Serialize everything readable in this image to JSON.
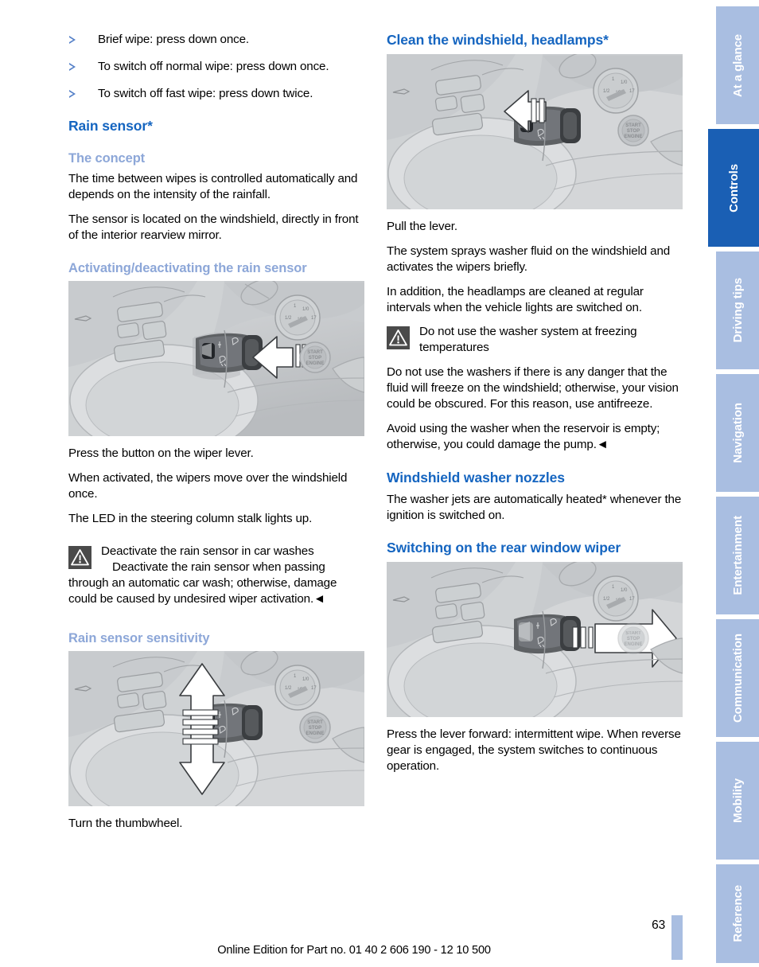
{
  "document": {
    "page_number": "63",
    "footer": "Online Edition for Part no. 01 40 2 606 190 - 12 10 500"
  },
  "left_column": {
    "bullets": [
      "Brief wipe: press down once.",
      "To switch off normal wipe: press down once.",
      "To switch off fast wipe: press down twice."
    ],
    "rain_sensor_heading": "Rain sensor*",
    "concept_heading": "The concept",
    "concept_p1": "The time between wipes is controlled automatically and depends on the intensity of the rainfall.",
    "concept_p2": "The sensor is located on the windshield, directly in front of the interior rearview mirror.",
    "activating_heading": "Activating/deactivating the rain sensor",
    "figure1_caption": "figure-wiper-lever-button-left-arrow",
    "activating_p1": "Press the button on the wiper lever.",
    "activating_p2": "When activated, the wipers move over the windshield once.",
    "activating_p3": "The LED in the steering column stalk lights up.",
    "warning_title": "Deactivate the rain sensor in car washes",
    "warning_body": "Deactivate the rain sensor when passing through an automatic car wash; otherwise, damage could be caused by undesired wiper activation.◄",
    "sensitivity_heading": "Rain sensor sensitivity",
    "figure2_caption": "figure-thumbwheel-up-down-arrow",
    "sensitivity_p1": "Turn the thumbwheel."
  },
  "right_column": {
    "clean_heading": "Clean the windshield, headlamps*",
    "figure3_caption": "figure-pull-lever-left-arrow",
    "clean_p1": "Pull the lever.",
    "clean_p2": "The system sprays washer fluid on the windshield and activates the wipers briefly.",
    "clean_p3": "In addition, the headlamps are cleaned at regular intervals when the vehicle lights are switched on.",
    "warning_title": "Do not use the washer system at freezing temperatures",
    "warning_p1": "Do not use the washers if there is any danger that the fluid will freeze on the windshield; otherwise, your vision could be obscured. For this reason, use antifreeze.",
    "warning_p2": "Avoid using the washer when the reservoir is empty; otherwise, you could damage the pump.◄",
    "nozzles_heading": "Windshield washer nozzles",
    "nozzles_p1": "The washer jets are automatically heated* whenever the ignition is switched on.",
    "rear_wiper_heading": "Switching on the rear window wiper",
    "figure4_caption": "figure-lever-forward-right-arrow",
    "rear_wiper_p1": "Press the lever forward: intermittent wipe. When reverse gear is engaged, the system switches to continuous operation."
  },
  "tab_rail": {
    "active_index": 1,
    "tabs": [
      {
        "label": "At a glance"
      },
      {
        "label": "Controls"
      },
      {
        "label": "Driving tips"
      },
      {
        "label": "Navigation"
      },
      {
        "label": "Entertainment"
      },
      {
        "label": "Communication"
      },
      {
        "label": "Mobility"
      },
      {
        "label": "Reference"
      }
    ]
  },
  "colors": {
    "heading_blue": "#1565c0",
    "subheading_blue": "#8da7d8",
    "tab_inactive": "#a9bee1",
    "tab_active": "#1a5fb4",
    "warning_icon": "#4a4a4a"
  }
}
